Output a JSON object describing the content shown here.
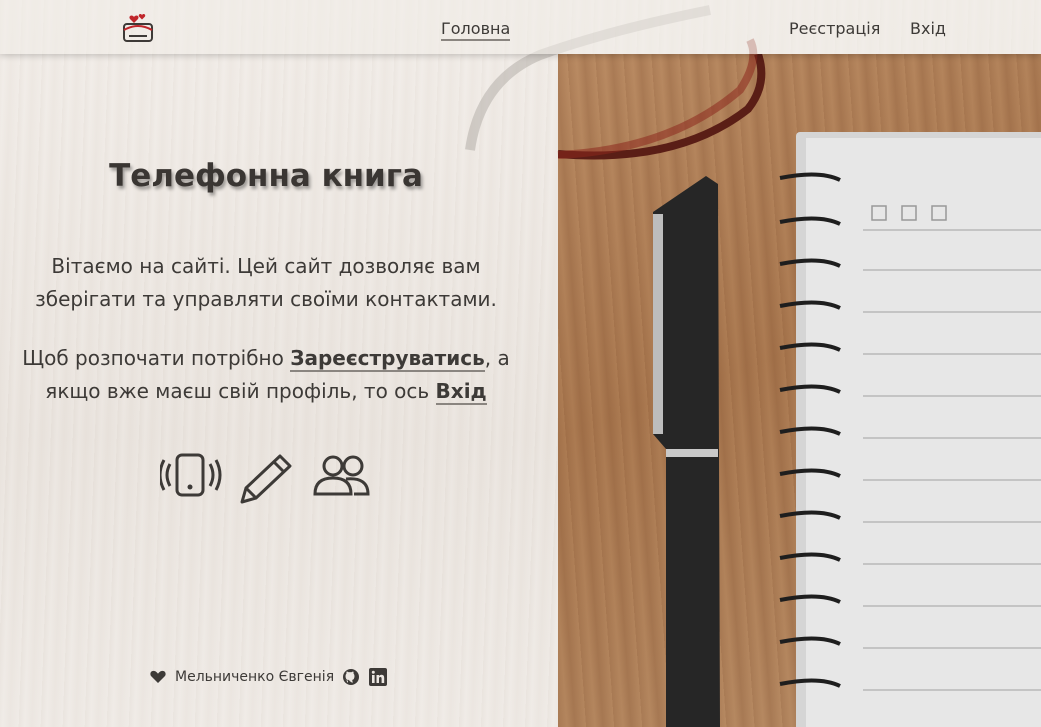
{
  "header": {
    "nav": {
      "home": "Головна",
      "register": "Реєстрація",
      "login": "Вхід"
    }
  },
  "main": {
    "title": "Телефонна книга",
    "intro": "Вітаємо на сайті. Цей сайт дозволяє вам зберігати та управляти своїми контактами.",
    "cta_prefix": "Щоб розпочати потрібно ",
    "cta_register_link": "Зареєструватись",
    "cta_middle": ", а якщо вже маєш свій профіль, то ось ",
    "cta_login_link": "Вхід",
    "feature_icons": [
      "phone-vibrate-icon",
      "pencil-icon",
      "people-icon"
    ]
  },
  "footer": {
    "author": "Мельниченко Євгенія",
    "icons": [
      "heart-icon",
      "github-icon",
      "linkedin-icon"
    ]
  },
  "colors": {
    "text": "#3d3a37",
    "logo_accent": "#c0262b",
    "underline": "#8a8580"
  }
}
